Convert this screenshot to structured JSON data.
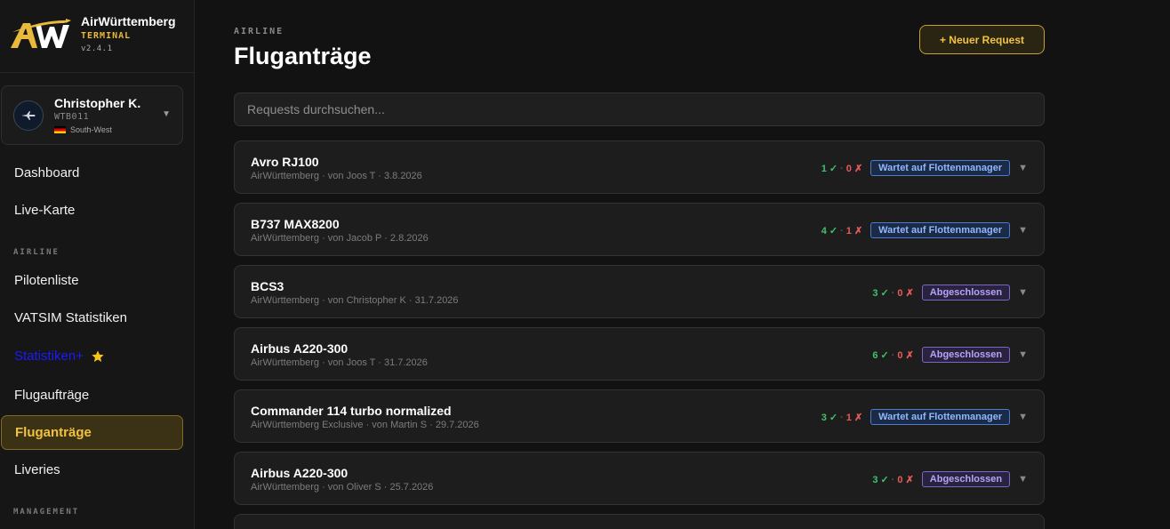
{
  "brand": {
    "name": "AirWürttemberg",
    "subtitle": "TERMINAL",
    "version": "v2.4.1",
    "accent": "#e8b93a"
  },
  "user": {
    "name": "Christopher K.",
    "id": "WTB011",
    "region": "South-West"
  },
  "nav": {
    "dashboard": "Dashboard",
    "live_map": "Live-Karte",
    "section_airline": "AIRLINE",
    "pilots": "Pilotenliste",
    "vatsim": "VATSIM Statistiken",
    "stats_plus": "Statistiken+",
    "flight_orders": "Flugaufträge",
    "flight_requests": "Fluganträge",
    "liveries": "Liveries",
    "section_management": "MANAGEMENT"
  },
  "main": {
    "eyebrow": "AIRLINE",
    "title": "Fluganträge",
    "new_button": "+ Neuer Request",
    "search_placeholder": "Requests durchsuchen..."
  },
  "requests": [
    {
      "title": "Avro RJ100",
      "meta": "AirWürttemberg · von Joos T · 3.8.2026",
      "yes": "1 ✓",
      "no": "0 ✗",
      "status": "Wartet auf Flottenmanager",
      "status_type": "wait"
    },
    {
      "title": "B737 MAX8200",
      "meta": "AirWürttemberg · von Jacob P · 2.8.2026",
      "yes": "4 ✓",
      "no": "1 ✗",
      "status": "Wartet auf Flottenmanager",
      "status_type": "wait"
    },
    {
      "title": "BCS3",
      "meta": "AirWürttemberg · von Christopher K · 31.7.2026",
      "yes": "3 ✓",
      "no": "0 ✗",
      "status": "Abgeschlossen",
      "status_type": "done"
    },
    {
      "title": "Airbus A220-300",
      "meta": "AirWürttemberg · von Joos T · 31.7.2026",
      "yes": "6 ✓",
      "no": "0 ✗",
      "status": "Abgeschlossen",
      "status_type": "done"
    },
    {
      "title": "Commander 114 turbo normalized",
      "meta": "AirWürttemberg Exclusive · von Martin S · 29.7.2026",
      "yes": "3 ✓",
      "no": "1 ✗",
      "status": "Wartet auf Flottenmanager",
      "status_type": "wait"
    },
    {
      "title": "Airbus A220-300",
      "meta": "AirWürttemberg · von Oliver S · 25.7.2026",
      "yes": "3 ✓",
      "no": "0 ✗",
      "status": "Abgeschlossen",
      "status_type": "done"
    }
  ],
  "colors": {
    "wait_badge": "#8fb7ff",
    "done_badge": "#b7a3f4",
    "vote_yes": "#3fc26b",
    "vote_no": "#e85a5a"
  },
  "icons": {
    "logo": "airwuerttemberg-logo",
    "star": "star-icon",
    "caret": "chevron-down-icon"
  }
}
